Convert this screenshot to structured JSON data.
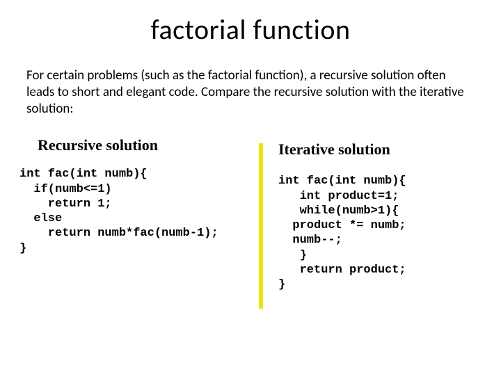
{
  "title": "factorial function",
  "intro": "For certain problems (such as the factorial function), a recursive solution often leads to short and elegant code. Compare the recursive solution with the iterative solution:",
  "left": {
    "heading": "Recursive solution",
    "code": "int fac(int numb){\n  if(numb<=1)\n    return 1;\n  else\n    return numb*fac(numb-1);\n}"
  },
  "right": {
    "heading": "Iterative solution",
    "code": "int fac(int numb){\n   int product=1;\n   while(numb>1){\n  product *= numb;\n  numb--;\n   }\n   return product;\n}"
  }
}
